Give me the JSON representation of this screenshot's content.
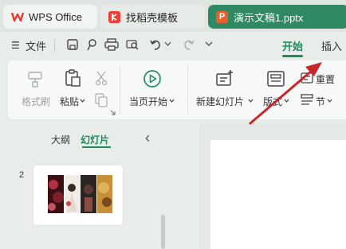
{
  "tabs": {
    "wps": {
      "label": "WPS Office",
      "icon": "wps-logo-icon"
    },
    "docer": {
      "label": "找稻壳模板",
      "icon": "docer-logo-icon"
    },
    "document": {
      "label": "演示文稿1.pptx",
      "icon": "presentation-file-icon",
      "icon_text": "P"
    }
  },
  "menu": {
    "hamburger": "☰",
    "file_label": "文件",
    "ribbon_tabs": [
      {
        "label": "开始",
        "active": true
      },
      {
        "label": "插入",
        "active": false
      }
    ]
  },
  "ribbon": {
    "format_painter": "格式刷",
    "paste": "粘贴",
    "play_from_current": "当页开始",
    "new_slide": "新建幻灯片",
    "layout": "版式",
    "reset": "重置",
    "section": "节"
  },
  "sidebar": {
    "tab_outline": "大纲",
    "tab_slides": "幻灯片",
    "collapse": "‹",
    "slide_number": "2"
  },
  "colors": {
    "accent": "#1f8b5c",
    "doc_tab": "#2f8a63",
    "wps_red": "#e33b33",
    "arrow": "#c8262b"
  }
}
